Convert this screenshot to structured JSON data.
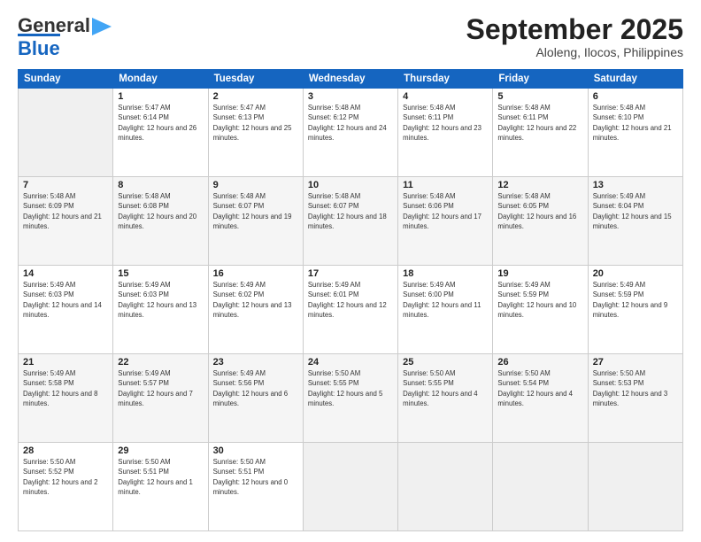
{
  "header": {
    "logo_general": "General",
    "logo_blue": "Blue",
    "month_title": "September 2025",
    "subtitle": "Aloleng, Ilocos, Philippines"
  },
  "weekdays": [
    "Sunday",
    "Monday",
    "Tuesday",
    "Wednesday",
    "Thursday",
    "Friday",
    "Saturday"
  ],
  "weeks": [
    [
      {
        "day": "",
        "sunrise": "",
        "sunset": "",
        "daylight": ""
      },
      {
        "day": "1",
        "sunrise": "Sunrise: 5:47 AM",
        "sunset": "Sunset: 6:14 PM",
        "daylight": "Daylight: 12 hours and 26 minutes."
      },
      {
        "day": "2",
        "sunrise": "Sunrise: 5:47 AM",
        "sunset": "Sunset: 6:13 PM",
        "daylight": "Daylight: 12 hours and 25 minutes."
      },
      {
        "day": "3",
        "sunrise": "Sunrise: 5:48 AM",
        "sunset": "Sunset: 6:12 PM",
        "daylight": "Daylight: 12 hours and 24 minutes."
      },
      {
        "day": "4",
        "sunrise": "Sunrise: 5:48 AM",
        "sunset": "Sunset: 6:11 PM",
        "daylight": "Daylight: 12 hours and 23 minutes."
      },
      {
        "day": "5",
        "sunrise": "Sunrise: 5:48 AM",
        "sunset": "Sunset: 6:11 PM",
        "daylight": "Daylight: 12 hours and 22 minutes."
      },
      {
        "day": "6",
        "sunrise": "Sunrise: 5:48 AM",
        "sunset": "Sunset: 6:10 PM",
        "daylight": "Daylight: 12 hours and 21 minutes."
      }
    ],
    [
      {
        "day": "7",
        "sunrise": "Sunrise: 5:48 AM",
        "sunset": "Sunset: 6:09 PM",
        "daylight": "Daylight: 12 hours and 21 minutes."
      },
      {
        "day": "8",
        "sunrise": "Sunrise: 5:48 AM",
        "sunset": "Sunset: 6:08 PM",
        "daylight": "Daylight: 12 hours and 20 minutes."
      },
      {
        "day": "9",
        "sunrise": "Sunrise: 5:48 AM",
        "sunset": "Sunset: 6:07 PM",
        "daylight": "Daylight: 12 hours and 19 minutes."
      },
      {
        "day": "10",
        "sunrise": "Sunrise: 5:48 AM",
        "sunset": "Sunset: 6:07 PM",
        "daylight": "Daylight: 12 hours and 18 minutes."
      },
      {
        "day": "11",
        "sunrise": "Sunrise: 5:48 AM",
        "sunset": "Sunset: 6:06 PM",
        "daylight": "Daylight: 12 hours and 17 minutes."
      },
      {
        "day": "12",
        "sunrise": "Sunrise: 5:48 AM",
        "sunset": "Sunset: 6:05 PM",
        "daylight": "Daylight: 12 hours and 16 minutes."
      },
      {
        "day": "13",
        "sunrise": "Sunrise: 5:49 AM",
        "sunset": "Sunset: 6:04 PM",
        "daylight": "Daylight: 12 hours and 15 minutes."
      }
    ],
    [
      {
        "day": "14",
        "sunrise": "Sunrise: 5:49 AM",
        "sunset": "Sunset: 6:03 PM",
        "daylight": "Daylight: 12 hours and 14 minutes."
      },
      {
        "day": "15",
        "sunrise": "Sunrise: 5:49 AM",
        "sunset": "Sunset: 6:03 PM",
        "daylight": "Daylight: 12 hours and 13 minutes."
      },
      {
        "day": "16",
        "sunrise": "Sunrise: 5:49 AM",
        "sunset": "Sunset: 6:02 PM",
        "daylight": "Daylight: 12 hours and 13 minutes."
      },
      {
        "day": "17",
        "sunrise": "Sunrise: 5:49 AM",
        "sunset": "Sunset: 6:01 PM",
        "daylight": "Daylight: 12 hours and 12 minutes."
      },
      {
        "day": "18",
        "sunrise": "Sunrise: 5:49 AM",
        "sunset": "Sunset: 6:00 PM",
        "daylight": "Daylight: 12 hours and 11 minutes."
      },
      {
        "day": "19",
        "sunrise": "Sunrise: 5:49 AM",
        "sunset": "Sunset: 5:59 PM",
        "daylight": "Daylight: 12 hours and 10 minutes."
      },
      {
        "day": "20",
        "sunrise": "Sunrise: 5:49 AM",
        "sunset": "Sunset: 5:59 PM",
        "daylight": "Daylight: 12 hours and 9 minutes."
      }
    ],
    [
      {
        "day": "21",
        "sunrise": "Sunrise: 5:49 AM",
        "sunset": "Sunset: 5:58 PM",
        "daylight": "Daylight: 12 hours and 8 minutes."
      },
      {
        "day": "22",
        "sunrise": "Sunrise: 5:49 AM",
        "sunset": "Sunset: 5:57 PM",
        "daylight": "Daylight: 12 hours and 7 minutes."
      },
      {
        "day": "23",
        "sunrise": "Sunrise: 5:49 AM",
        "sunset": "Sunset: 5:56 PM",
        "daylight": "Daylight: 12 hours and 6 minutes."
      },
      {
        "day": "24",
        "sunrise": "Sunrise: 5:50 AM",
        "sunset": "Sunset: 5:55 PM",
        "daylight": "Daylight: 12 hours and 5 minutes."
      },
      {
        "day": "25",
        "sunrise": "Sunrise: 5:50 AM",
        "sunset": "Sunset: 5:55 PM",
        "daylight": "Daylight: 12 hours and 4 minutes."
      },
      {
        "day": "26",
        "sunrise": "Sunrise: 5:50 AM",
        "sunset": "Sunset: 5:54 PM",
        "daylight": "Daylight: 12 hours and 4 minutes."
      },
      {
        "day": "27",
        "sunrise": "Sunrise: 5:50 AM",
        "sunset": "Sunset: 5:53 PM",
        "daylight": "Daylight: 12 hours and 3 minutes."
      }
    ],
    [
      {
        "day": "28",
        "sunrise": "Sunrise: 5:50 AM",
        "sunset": "Sunset: 5:52 PM",
        "daylight": "Daylight: 12 hours and 2 minutes."
      },
      {
        "day": "29",
        "sunrise": "Sunrise: 5:50 AM",
        "sunset": "Sunset: 5:51 PM",
        "daylight": "Daylight: 12 hours and 1 minute."
      },
      {
        "day": "30",
        "sunrise": "Sunrise: 5:50 AM",
        "sunset": "Sunset: 5:51 PM",
        "daylight": "Daylight: 12 hours and 0 minutes."
      },
      {
        "day": "",
        "sunrise": "",
        "sunset": "",
        "daylight": ""
      },
      {
        "day": "",
        "sunrise": "",
        "sunset": "",
        "daylight": ""
      },
      {
        "day": "",
        "sunrise": "",
        "sunset": "",
        "daylight": ""
      },
      {
        "day": "",
        "sunrise": "",
        "sunset": "",
        "daylight": ""
      }
    ]
  ]
}
